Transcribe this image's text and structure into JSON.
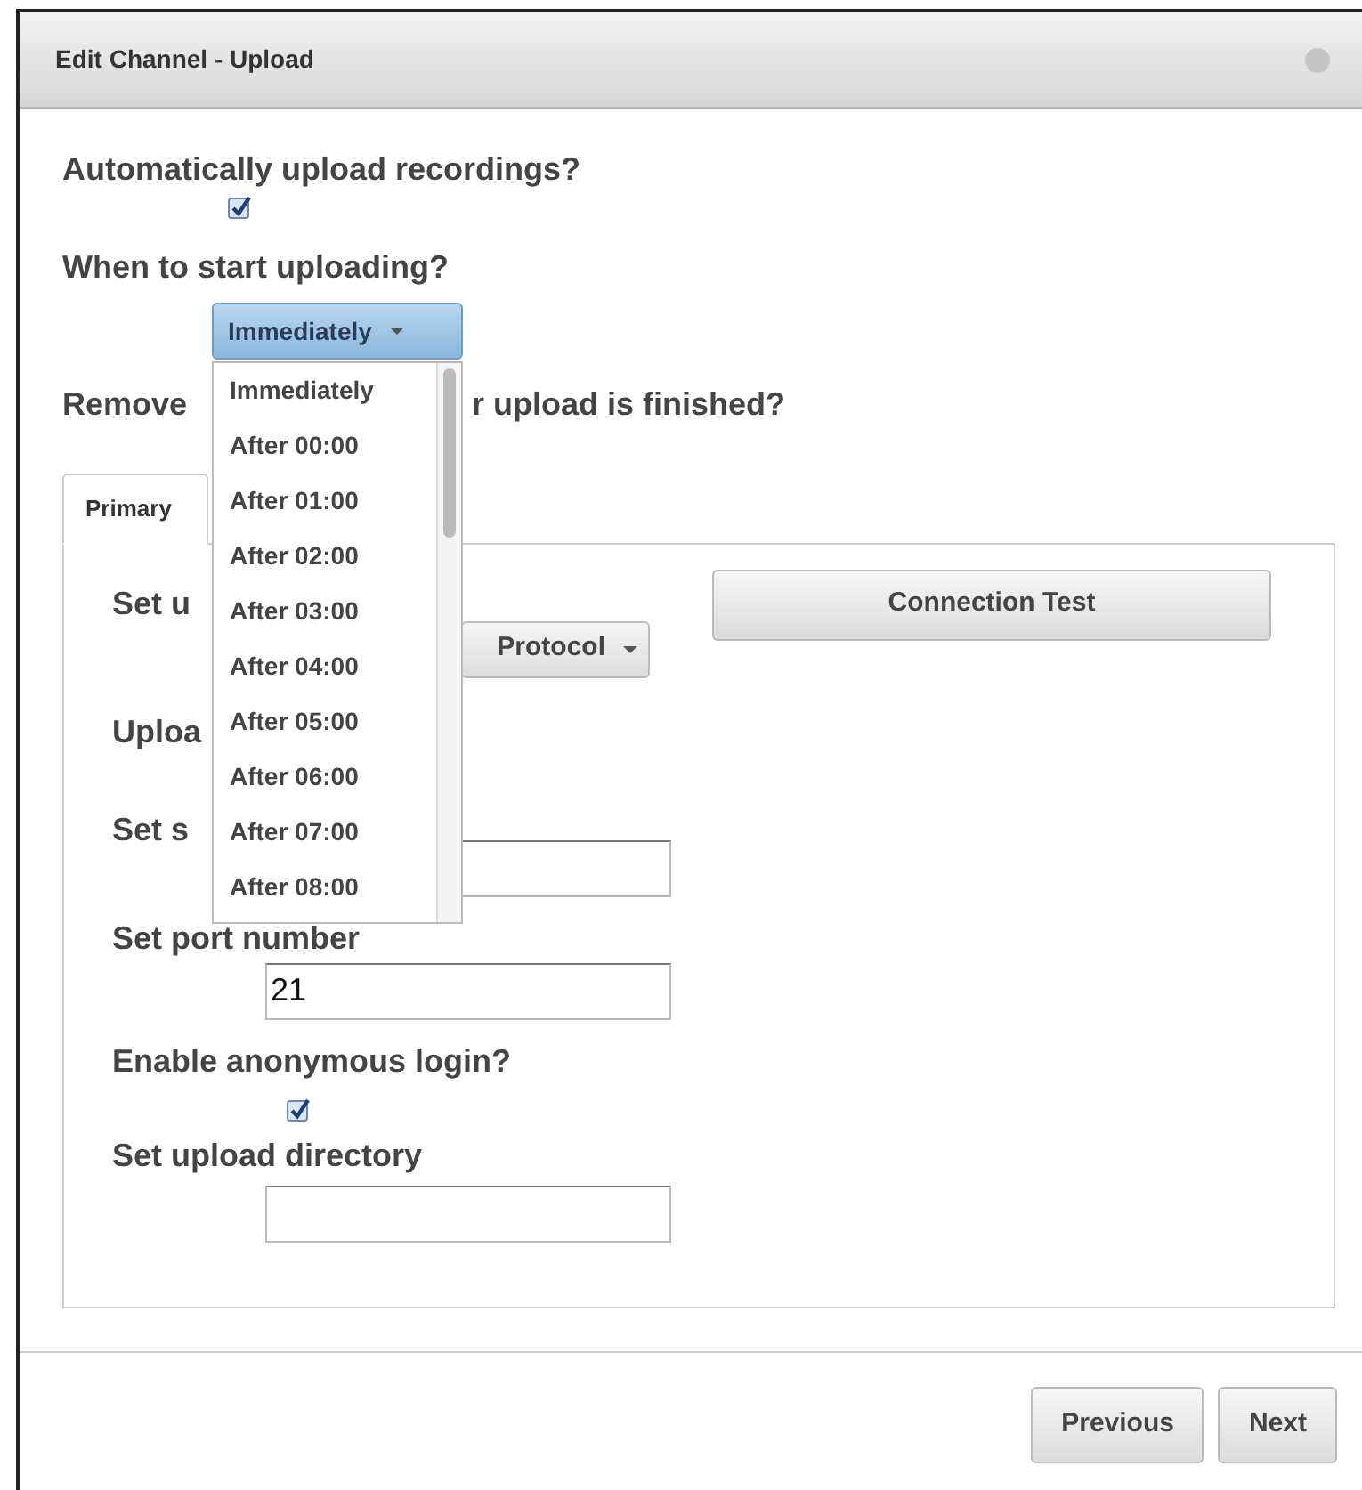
{
  "window": {
    "title": "Edit Channel - Upload"
  },
  "auto_upload": {
    "label": "Automatically upload recordings?",
    "checked": true
  },
  "start_upload": {
    "label": "When to start uploading?",
    "value": "Immediately",
    "expanded": true,
    "options": [
      "Immediately",
      "After 00:00",
      "After 01:00",
      "After 02:00",
      "After 03:00",
      "After 04:00",
      "After 05:00",
      "After 06:00",
      "After 07:00",
      "After 08:00"
    ]
  },
  "remove_label": {
    "part_1": "Remove",
    "part_2": "r upload is finished?"
  },
  "tabs": [
    {
      "label": "Primary",
      "selected": true
    }
  ],
  "panel": {
    "upload_label": "Set u",
    "connection_test": "Connection Test",
    "protocol": "Protocol",
    "uploa_label": "Uploa",
    "server_label": "Set s",
    "port_label": "Set port number",
    "port_value": "21",
    "anonymous": {
      "label": "Enable anonymous login?",
      "checked": true
    },
    "directory_label": "Set upload directory"
  },
  "buttons": [
    "Previous",
    "Next"
  ]
}
